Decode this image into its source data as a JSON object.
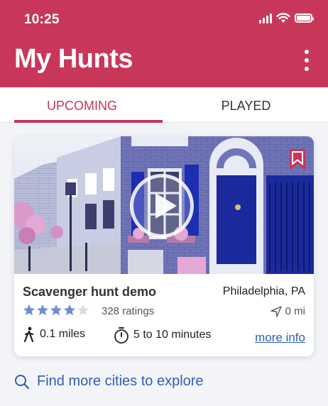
{
  "status_bar": {
    "time": "10:25"
  },
  "header": {
    "title": "My Hunts",
    "menu_icon": "kebab-menu-icon"
  },
  "tabs": [
    {
      "label": "UPCOMING",
      "active": true
    },
    {
      "label": "PLAYED",
      "active": false
    }
  ],
  "hunt_card": {
    "name": "Scavenger hunt demo",
    "city": "Philadelphia, PA",
    "rating_stars": 4,
    "rating_max": 5,
    "ratings_count": "328 ratings",
    "distance": "0 mi",
    "walk_distance": "0.1 miles",
    "duration": "5 to 10 minutes",
    "more_info_label": "more info"
  },
  "footer": {
    "find_more_label": "Find more cities to explore"
  },
  "colors": {
    "brand": "#c8375a",
    "link": "#2f5fb4",
    "star_filled": "#6c8fd1",
    "star_empty": "#d8dbe3"
  }
}
